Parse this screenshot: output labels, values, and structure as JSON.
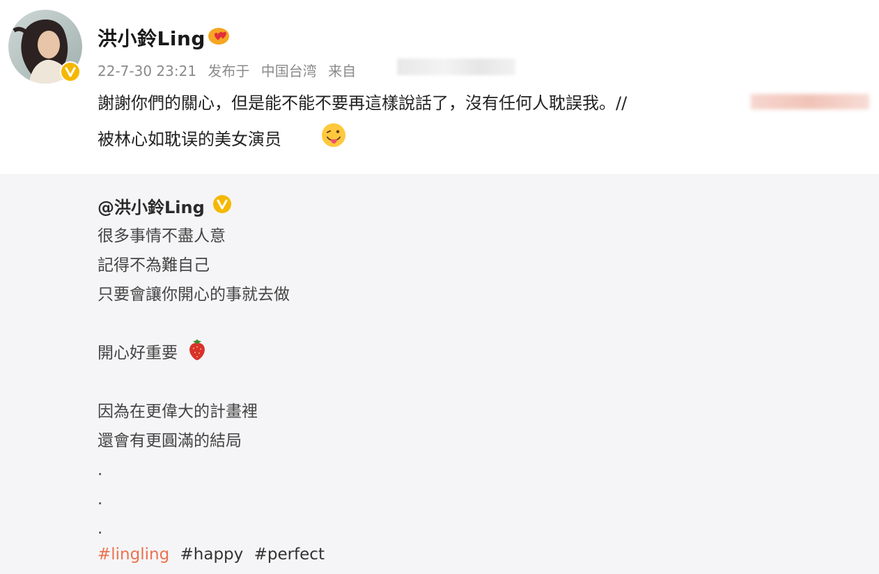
{
  "post": {
    "author": "洪小鈴Ling",
    "meta": {
      "date": "22-7-30 23:21",
      "published_at": "发布于",
      "location": "中国台湾",
      "from": "来自"
    },
    "text": "謝謝你們的關心，但是能不能不要再這樣說話了，沒有任何人耽誤我。//",
    "text_continued": "被林心如耽误的美女演员",
    "icons": {
      "verified": "verified-badge-icon",
      "user_badge": "heart-badge-icon",
      "emoji": "tongue-out-emoji-icon"
    },
    "colors": {
      "verified": "#f5b800",
      "hashtag": "#eb7350",
      "repost_bg": "#f5f5f7"
    }
  },
  "repost": {
    "author": "@洪小鈴Ling",
    "lines": [
      "很多事情不盡人意",
      "記得不為難自己",
      "只要會讓你開心的事就去做",
      "",
      "開心好重要",
      "",
      "因為在更偉大的計畫裡",
      "還會有更圓滿的結局",
      ".",
      ".",
      "."
    ],
    "icons": {
      "strawberry": "strawberry-emoji-icon"
    },
    "hashtags": [
      "#lingling",
      "#happy",
      "#perfect"
    ]
  }
}
